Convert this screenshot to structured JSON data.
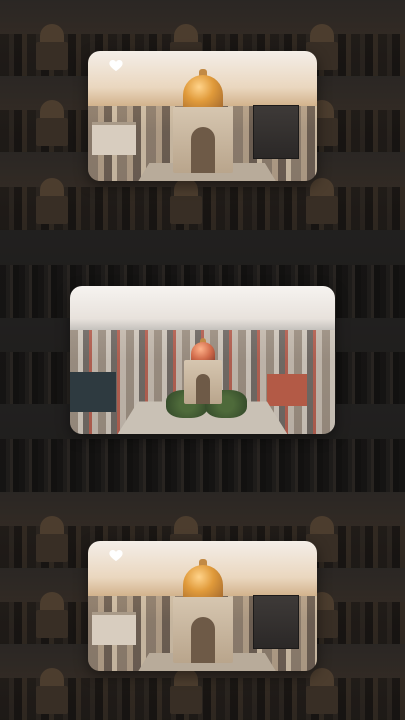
{
  "feed": {
    "cards": [
      {
        "scene": "monument-sunset-closeup",
        "favorite_icon": "heart-icon",
        "favorited": false
      },
      {
        "scene": "monument-aerial-wide"
      },
      {
        "scene": "monument-sunset-closeup",
        "favorite_icon": "heart-icon",
        "favorited": false
      }
    ],
    "background": "tiled-city-thumbnails"
  },
  "colors": {
    "page_background": "#2b2b2b",
    "heart_outline": "#ffffff",
    "dome_gold": "#e09a3a",
    "dome_red": "#d06a4a"
  }
}
